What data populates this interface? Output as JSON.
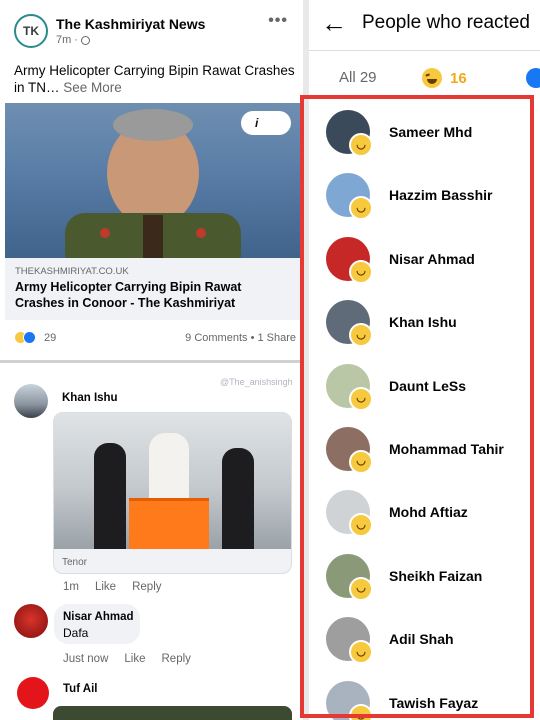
{
  "post": {
    "page_logo_text": "TK",
    "page_name": "The Kashmiriyat News",
    "time": "7m",
    "text": "Army Helicopter Carrying Bipin Rawat Crashes in TN…",
    "see_more": "See More",
    "info_label": "i",
    "link_domain": "THEKASHMIRIYAT.CO.UK",
    "link_title": "Army Helicopter Carrying Bipin Rawat Crashes in Conoor - The Kashmiriyat",
    "reaction_count": "29",
    "comments_shares": "9 Comments • 1 Share"
  },
  "watermark": "@The_anishsingh",
  "comments": [
    {
      "author": "Khan Ishu",
      "gif_label": "Tenor",
      "actions": [
        "1m",
        "Like",
        "Reply"
      ]
    },
    {
      "author": "Nisar Ahmad",
      "text": "Dafa",
      "actions": [
        "Just now",
        "Like",
        "Reply"
      ]
    },
    {
      "author": "Tuf Ail"
    }
  ],
  "reactions_panel": {
    "title": "People who reacted",
    "tab_all": "All 29",
    "tab_haha_count": "16",
    "people": [
      {
        "name": "Sameer Mhd"
      },
      {
        "name": "Hazzim Basshir"
      },
      {
        "name": "Nisar Ahmad"
      },
      {
        "name": "Khan Ishu"
      },
      {
        "name": "Daunt LeSs"
      },
      {
        "name": "Mohammad Tahir"
      },
      {
        "name": "Mohd Aftiaz"
      },
      {
        "name": "Sheikh Faizan"
      },
      {
        "name": "Adil Shah"
      },
      {
        "name": "Tawish Fayaz"
      }
    ]
  },
  "colors": {
    "highlight": "#e53935",
    "haha": "#f7c93e",
    "like": "#1877f2"
  }
}
